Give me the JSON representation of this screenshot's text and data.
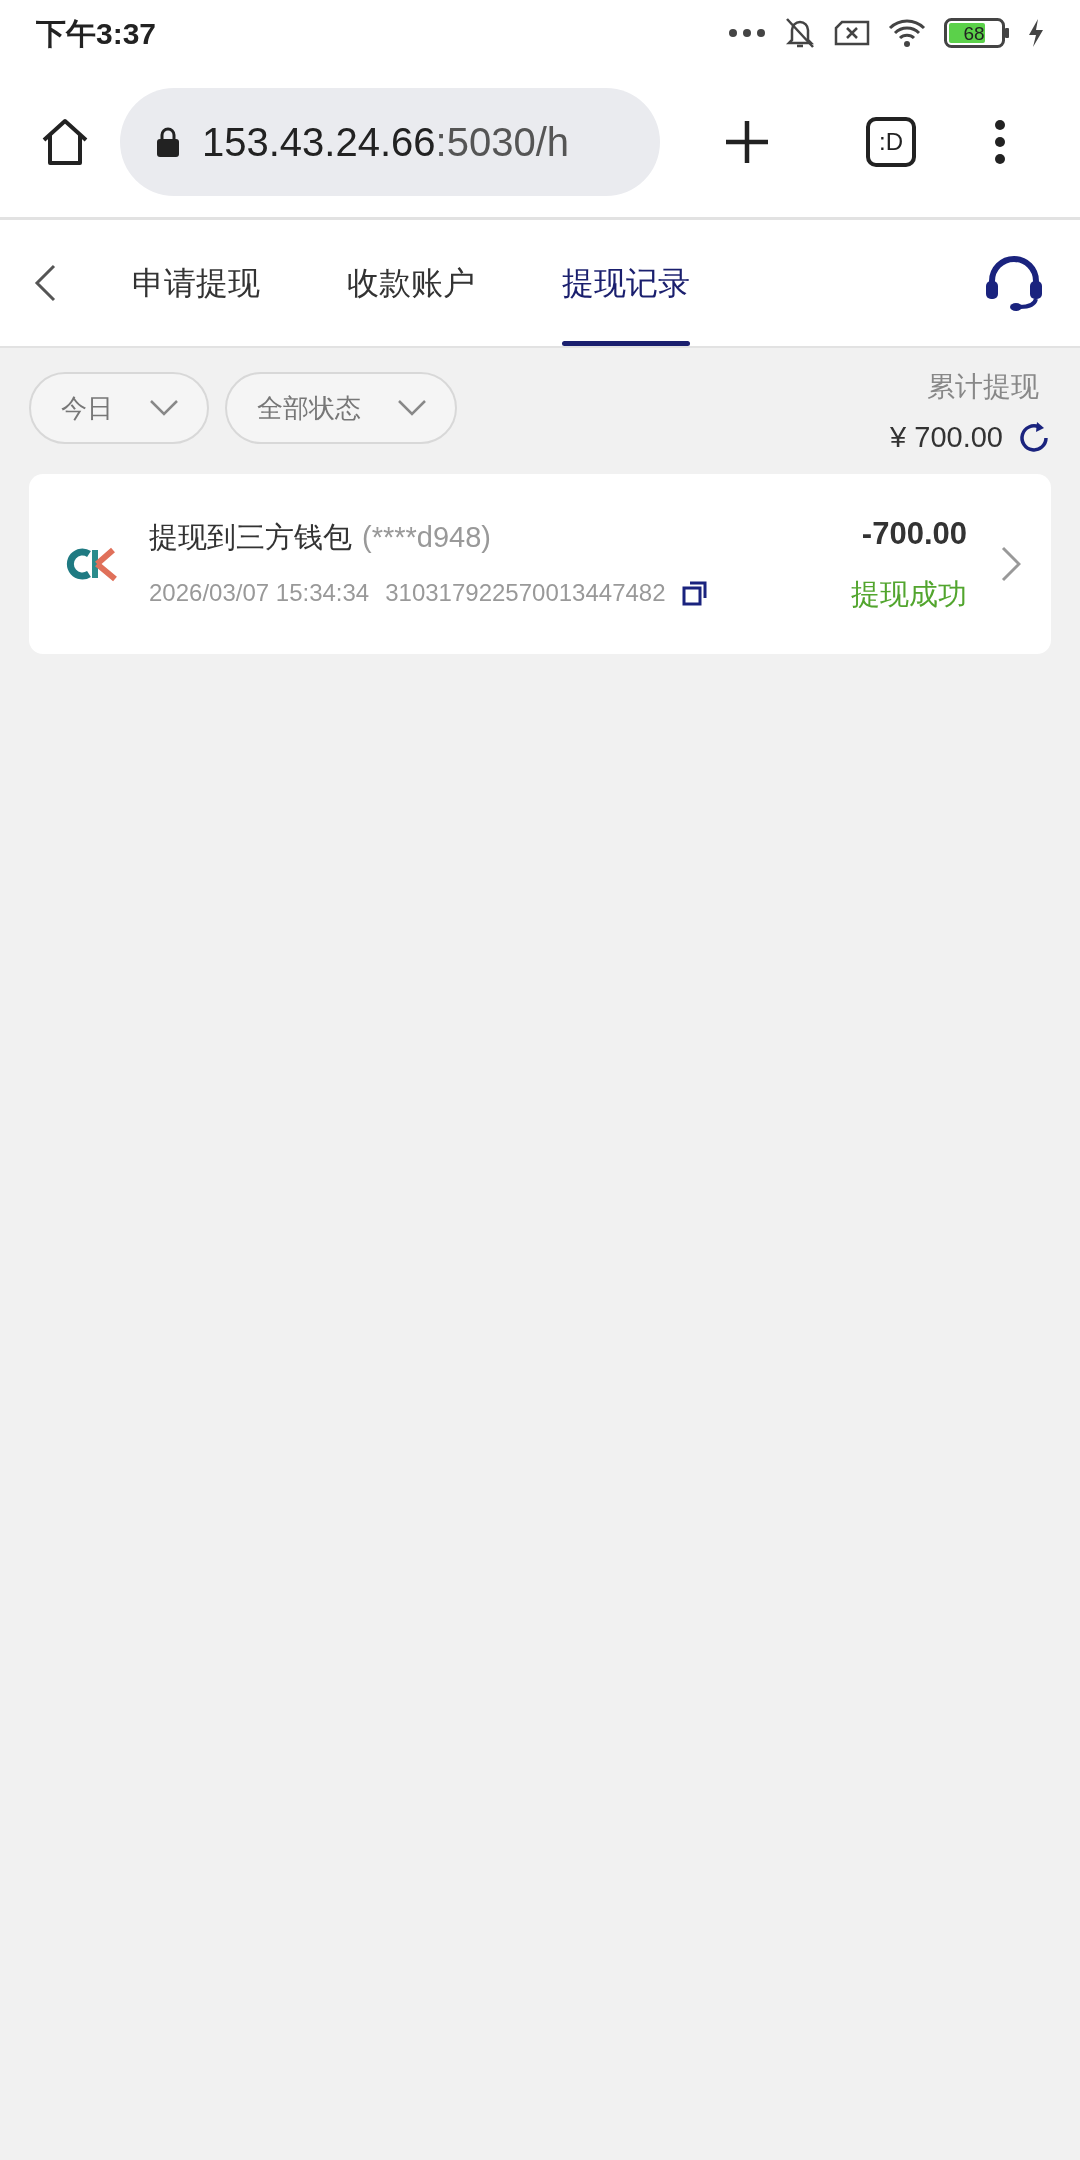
{
  "status_bar": {
    "time": "下午3:37",
    "battery": "68"
  },
  "browser": {
    "url_host": "153.43.24.66",
    "url_rest": ":5030/h",
    "tab_switcher": ":D"
  },
  "tabs": [
    {
      "label": "申请提现",
      "selected": false
    },
    {
      "label": "收款账户",
      "selected": false
    },
    {
      "label": "提现记录",
      "selected": true
    }
  ],
  "filters": [
    {
      "label": "今日"
    },
    {
      "label": "全部状态"
    }
  ],
  "total": {
    "label": "累计提现",
    "amount": "¥ 700.00"
  },
  "records": [
    {
      "title": "提现到三方钱包",
      "account": "(****d948)",
      "time": "2026/03/07 15:34:34",
      "order_no": "310317922570013447482",
      "amount": "-700.00",
      "status": "提现成功",
      "color": "#52a52e"
    }
  ]
}
